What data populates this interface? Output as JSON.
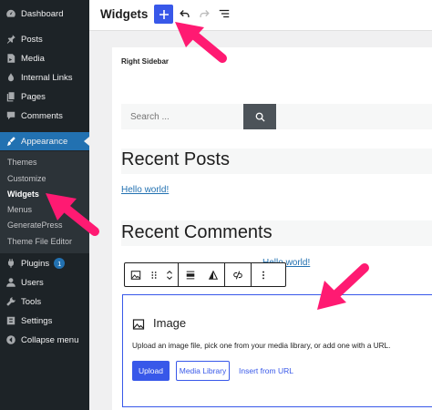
{
  "sidebar": {
    "items": [
      {
        "label": "Dashboard",
        "icon": "dashboard-icon"
      },
      {
        "label": "Posts",
        "icon": "pushpin-icon"
      },
      {
        "label": "Media",
        "icon": "media-icon"
      },
      {
        "label": "Internal Links",
        "icon": "link-icon"
      },
      {
        "label": "Pages",
        "icon": "pages-icon"
      },
      {
        "label": "Comments",
        "icon": "comment-icon"
      },
      {
        "label": "Appearance",
        "icon": "paintbrush-icon"
      }
    ],
    "submenu": [
      "Themes",
      "Customize",
      "Widgets",
      "Menus",
      "GeneratePress",
      "Theme File Editor"
    ],
    "current_submenu": "Widgets",
    "lower_items": [
      {
        "label": "Plugins",
        "icon": "plugins-icon",
        "badge": "1"
      },
      {
        "label": "Users",
        "icon": "users-icon"
      },
      {
        "label": "Tools",
        "icon": "wrench-icon"
      },
      {
        "label": "Settings",
        "icon": "settings-icon"
      },
      {
        "label": "Collapse menu",
        "icon": "collapse-icon"
      }
    ]
  },
  "header": {
    "title": "Widgets"
  },
  "canvas": {
    "area_title": "Right Sidebar",
    "search_placeholder": "Search ...",
    "recent_posts_heading": "Recent Posts",
    "recent_post_link": "Hello world!",
    "recent_comments_heading": "Recent Comments",
    "recent_comment_link": "Hello world!"
  },
  "image_block": {
    "title": "Image",
    "instructions": "Upload an image file, pick one from your media library, or add one with a URL.",
    "upload_label": "Upload",
    "library_label": "Media Library",
    "url_label": "Insert from URL"
  },
  "colors": {
    "admin_sidebar": "#1d2327",
    "active_menu": "#2271b1",
    "editor_accent": "#3858e9",
    "arrow": "#ff1a72"
  }
}
